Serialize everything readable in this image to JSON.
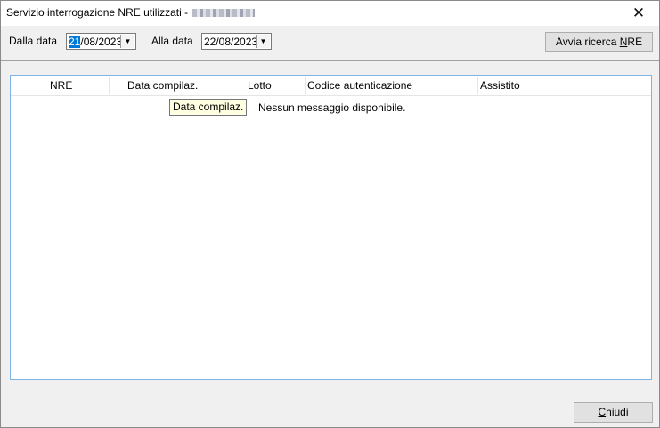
{
  "window": {
    "title": "Servizio interrogazione NRE utilizzati -",
    "close_glyph": "✕"
  },
  "filters": {
    "from_label": "Dalla data",
    "from_value_selected": "21",
    "from_value_rest": "/08/2023",
    "to_label": "Alla data",
    "to_value": "22/08/2023",
    "dropdown_glyph": "▼"
  },
  "search_button": {
    "label_prefix": "Avvia ricerca ",
    "label_accel": "N",
    "label_suffix": "RE"
  },
  "table": {
    "columns": [
      "NRE",
      "Data compilaz.",
      "Lotto",
      "Codice autenticazione",
      "Assistito"
    ],
    "empty_message": "Nessun messaggio disponibile.",
    "tooltip": "Data compilaz."
  },
  "close_button": {
    "label_accel": "C",
    "label_rest": "hiudi"
  }
}
